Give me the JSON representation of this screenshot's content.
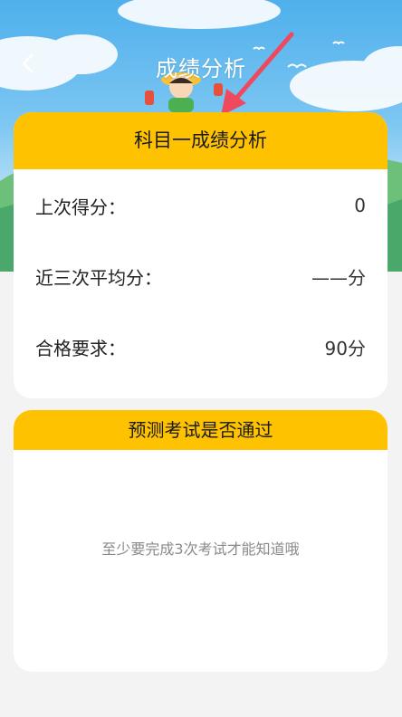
{
  "header": {
    "title": "成绩分析",
    "back_icon": "chevron-left-icon"
  },
  "colors": {
    "accent": "#ffc200",
    "sky": "#5bb5ee",
    "background": "#f3f3f3",
    "arrow": "#f0485d"
  },
  "analysis_card": {
    "title": "科目一成绩分析",
    "rows": [
      {
        "label": "上次得分：",
        "value": "0"
      },
      {
        "label": "近三次平均分：",
        "value": "——分"
      },
      {
        "label": "合格要求：",
        "value": "90分"
      }
    ]
  },
  "prediction_card": {
    "title": "预测考试是否通过",
    "hint": "至少要完成3次考试才能知道哦"
  }
}
